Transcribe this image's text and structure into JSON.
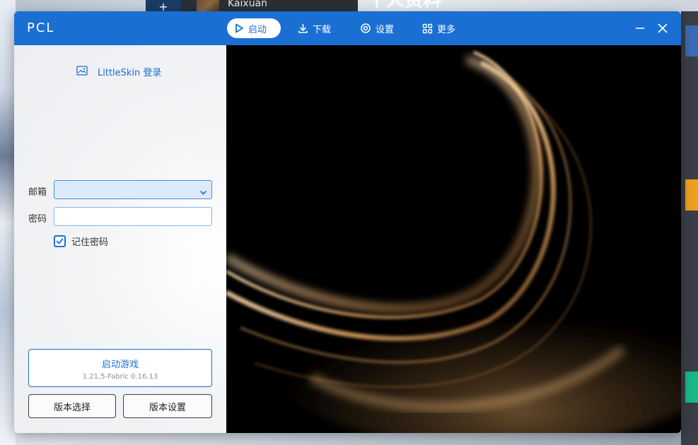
{
  "background": {
    "user_name": "Kaixuan",
    "profile_title": "个人资料",
    "plus_glyph": "+"
  },
  "titlebar": {
    "app_title": "PCL",
    "nav": [
      {
        "label": "启动",
        "icon": "play-icon",
        "active": true
      },
      {
        "label": "下载",
        "icon": "download-icon",
        "active": false
      },
      {
        "label": "设置",
        "icon": "gear-icon",
        "active": false
      },
      {
        "label": "更多",
        "icon": "grid-icon",
        "active": false
      }
    ],
    "controls": [
      "minimize-icon",
      "close-icon"
    ]
  },
  "login": {
    "title": "LittleSkin 登录",
    "icon": "picture-icon",
    "email_label": "邮箱",
    "email_value": "",
    "password_label": "密码",
    "password_value": "",
    "remember_label": "记住密码",
    "remember_checked": true
  },
  "actions": {
    "launch_title": "启动游戏",
    "launch_version": "1.21.5-Fabric 0.16.13",
    "version_select": "版本选择",
    "version_settings": "版本设置"
  },
  "colors": {
    "accent": "#1a6fd3",
    "panel_bg": "#f2f3f5",
    "wallpaper_gold": "#d9a86a"
  }
}
